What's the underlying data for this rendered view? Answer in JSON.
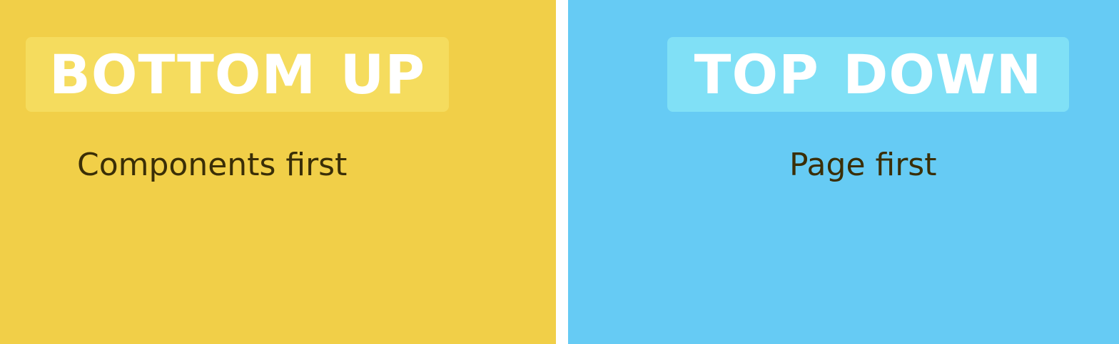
{
  "left_panel": {
    "title": "BOTTOM UP",
    "subtitle": "Components first",
    "background": "#F1CF48",
    "title_highlight": "#F5DC5E"
  },
  "right_panel": {
    "title": "TOP DOWN",
    "subtitle": "Page first",
    "background": "#66CBF4",
    "title_highlight": "#80E0F6"
  }
}
